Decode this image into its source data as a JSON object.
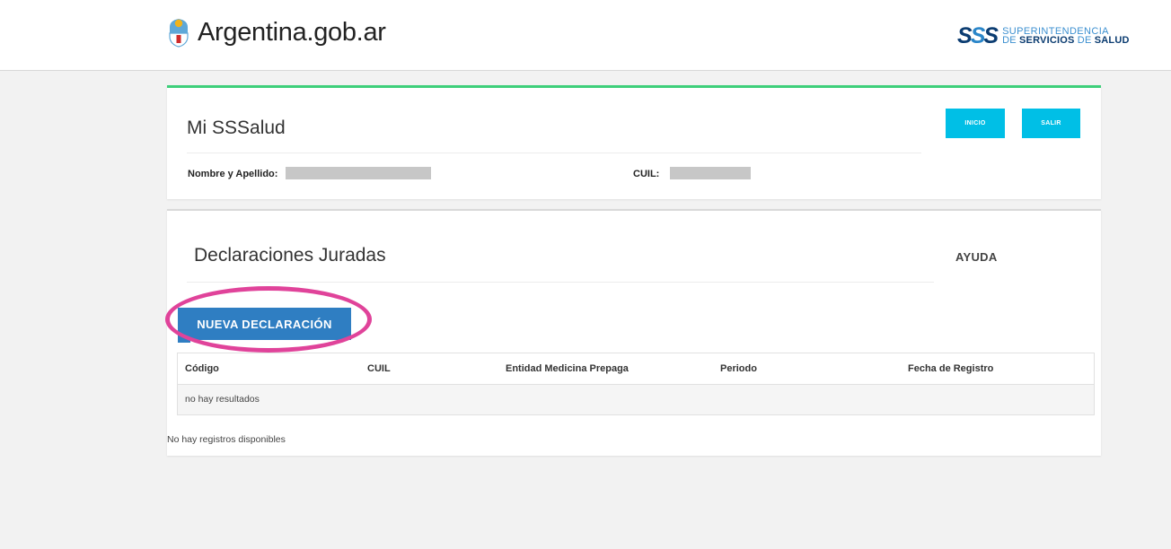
{
  "header": {
    "site_name": "Argentina.gob.ar",
    "partner_logo": {
      "mark": "SSS",
      "line1": "SUPERINTENDENCIA",
      "line2_prefix": "DE",
      "line2_bold": "SERVICIOS",
      "line2_mid": "DE",
      "line2_end": "SALUD"
    }
  },
  "profile_card": {
    "title": "Mi SSSalud",
    "name_label": "Nombre y Apellido:",
    "cuil_label": "CUIL:",
    "inicio_label": "INICIO",
    "salir_label": "SALIR"
  },
  "declarations": {
    "title": "Declaraciones Juradas",
    "help_label": "AYUDA",
    "new_button_label": "NUEVA DECLARACIÓN",
    "table": {
      "columns": [
        "Código",
        "CUIL",
        "Entidad Medicina Prepaga",
        "Periodo",
        "Fecha de Registro"
      ],
      "empty_row": "no hay resultados"
    },
    "footer_note": "No hay registros disponibles"
  },
  "colors": {
    "accent_green": "#3ecf7a",
    "button_cyan": "#00bfe6",
    "button_blue": "#2f7ec2",
    "highlight_pink": "#e0439a"
  }
}
